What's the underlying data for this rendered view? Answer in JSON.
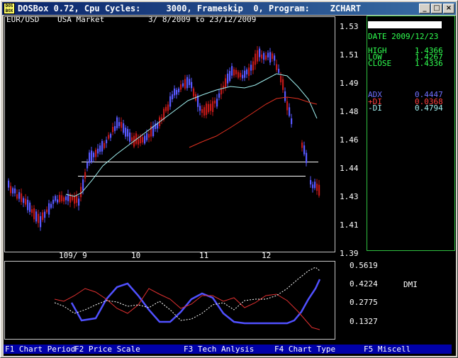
{
  "window": {
    "title": "DOSBox 0.72, Cpu Cycles:     3000, Frameskip  0, Program:    ZCHART",
    "icon_label": "DOS BOX",
    "buttons": {
      "minimize": "_",
      "maximize": "□",
      "close": "×"
    }
  },
  "chart": {
    "symbol": "EUR/USD",
    "market": "USA Market",
    "date_range": "3/ 8/2009 to 23/12/2009",
    "price_labels": [
      "1.53",
      "1.51",
      "1.49",
      "1.48",
      "1.46",
      "1.44",
      "1.43",
      "1.41",
      "1.39"
    ],
    "month_labels": [
      "109/ 9",
      "10",
      "11",
      "12"
    ],
    "indicator_labels": [
      "0.5619",
      "0.4224",
      "0.2775",
      "0.1327"
    ],
    "indicator_name": "DMI"
  },
  "info_panel": {
    "date": "DATE 2009/12/23",
    "high_label": "HIGH",
    "high_value": "1.4366",
    "low_label": "LOW",
    "low_value": "1.4267",
    "close_label": "CLOSE",
    "close_value": "1.4336",
    "adx_label": "ADX",
    "adx_value": "0.4447",
    "pdi_label": "+DI",
    "pdi_value": "0.0368",
    "mdi_label": "-DI",
    "mdi_value": "0.4794"
  },
  "function_keys": [
    {
      "key": "F1",
      "label": "Chart Period"
    },
    {
      "key": "F2",
      "label": "Price Scale"
    },
    {
      "key": "F3",
      "label": "Tech Anlysis"
    },
    {
      "key": "F4",
      "label": "Chart Type"
    },
    {
      "key": "F5",
      "label": "Miscell"
    }
  ],
  "colors": {
    "up_candle": "#5858ff",
    "down_candle": "#c01818",
    "ma_short": "#a0f0f0",
    "ma_long": "#e03020",
    "adx": "#5050ff",
    "plus_di": "#e03030",
    "minus_di": "#ffffff",
    "panel_text": "#30ff50",
    "fkey_bar": "#0000a8"
  }
}
